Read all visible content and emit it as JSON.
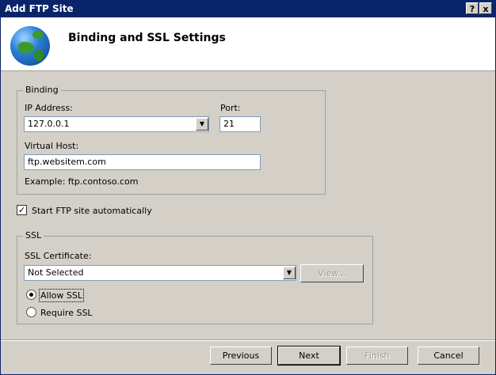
{
  "window": {
    "title": "Add FTP Site",
    "help_button": "?",
    "close_button": "x"
  },
  "header": {
    "title": "Binding and SSL Settings",
    "icon": "globe-icon"
  },
  "binding": {
    "group_label": "Binding",
    "ip_label": "IP Address:",
    "ip_value": "127.0.0.1",
    "port_label": "Port:",
    "port_value": "21",
    "virtual_host_label": "Virtual Host:",
    "virtual_host_value": "ftp.websitem.com",
    "example_text": "Example: ftp.contoso.com"
  },
  "start_auto": {
    "label": "Start FTP site automatically",
    "checked": true
  },
  "ssl": {
    "group_label": "SSL",
    "certificate_label": "SSL Certificate:",
    "certificate_value": "Not Selected",
    "view_button": "View...",
    "allow_label": "Allow SSL",
    "require_label": "Require SSL",
    "selected": "Allow SSL"
  },
  "footer": {
    "previous": "Previous",
    "next": "Next",
    "finish": "Finish",
    "cancel": "Cancel"
  },
  "colors": {
    "titlebar": "#0a246a",
    "face": "#d4d0c8",
    "field_border": "#7f9db9"
  }
}
